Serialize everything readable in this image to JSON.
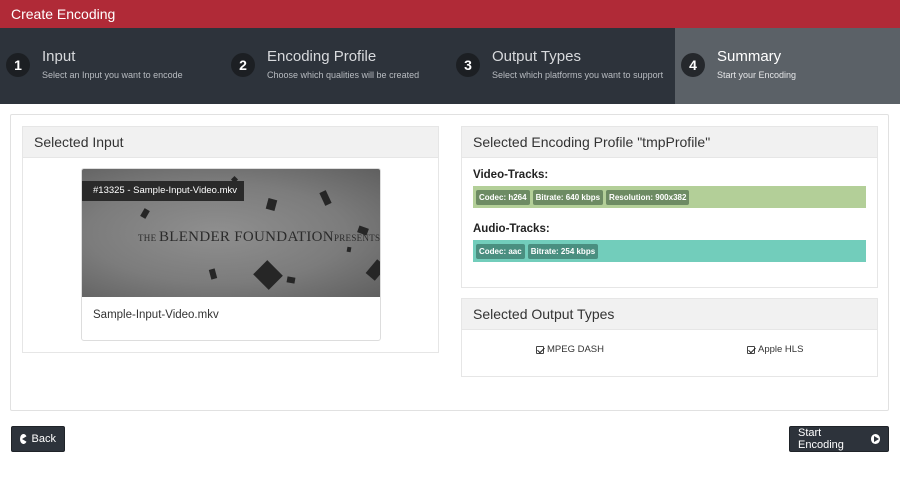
{
  "app": {
    "title": "Create Encoding"
  },
  "steps": [
    {
      "number": "1",
      "title": "Input",
      "subtitle": "Select an Input you want to encode",
      "active": false
    },
    {
      "number": "2",
      "title": "Encoding Profile",
      "subtitle": "Choose which qualities will be created",
      "active": false
    },
    {
      "number": "3",
      "title": "Output Types",
      "subtitle": "Select which platforms you want to support",
      "active": false
    },
    {
      "number": "4",
      "title": "Summary",
      "subtitle": "Start your Encoding",
      "active": true
    }
  ],
  "selected_input": {
    "heading": "Selected Input",
    "badge": "#13325 - Sample-Input-Video.mkv",
    "thumbnail_text": {
      "the": "THE ",
      "blender": "BLENDER ",
      "foundation": "FOUNDATION",
      "presents": "PRESENTS"
    },
    "file_name": "Sample-Input-Video.mkv"
  },
  "profile": {
    "heading": "Selected Encoding Profile \"tmpProfile\"",
    "video_label": "Video-Tracks:",
    "video_tags": [
      "Codec: h264",
      "Bitrate: 640 kbps",
      "Resolution: 900x382"
    ],
    "audio_label": "Audio-Tracks:",
    "audio_tags": [
      "Codec: aac",
      "Bitrate: 254 kbps"
    ]
  },
  "outputs": {
    "heading": "Selected Output Types",
    "items": [
      "MPEG DASH",
      "Apple HLS"
    ]
  },
  "buttons": {
    "back": "Back",
    "start": "Start Encoding"
  },
  "colors": {
    "titlebar": "#b02a37",
    "stepbar": "#2d333b",
    "active_step": "#5b6167",
    "video_track": "#b3cf98",
    "audio_track": "#72cdbb"
  }
}
